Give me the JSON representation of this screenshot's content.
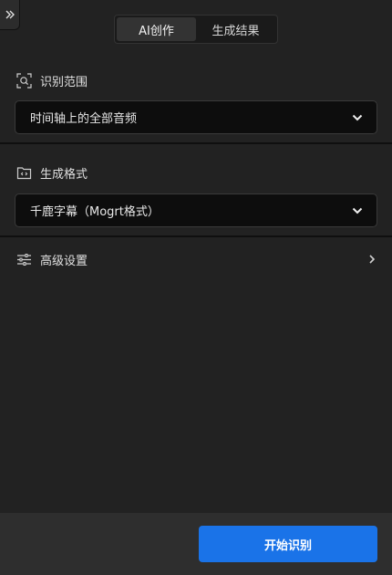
{
  "tabs": [
    {
      "label": "AI创作",
      "active": true
    },
    {
      "label": "生成结果",
      "active": false
    }
  ],
  "recognition_range": {
    "label": "识别范围",
    "icon": "scan-search-icon",
    "selected": "时间轴上的全部音频"
  },
  "output_format": {
    "label": "生成格式",
    "icon": "folder-code-icon",
    "selected": "千鹿字幕（Mogrt格式）"
  },
  "advanced": {
    "label": "高级设置",
    "icon": "sliders-icon"
  },
  "footer": {
    "start_label": "开始识别"
  },
  "colors": {
    "background": "#222222",
    "footer": "#2e2e2e",
    "accent": "#1a73e8"
  }
}
